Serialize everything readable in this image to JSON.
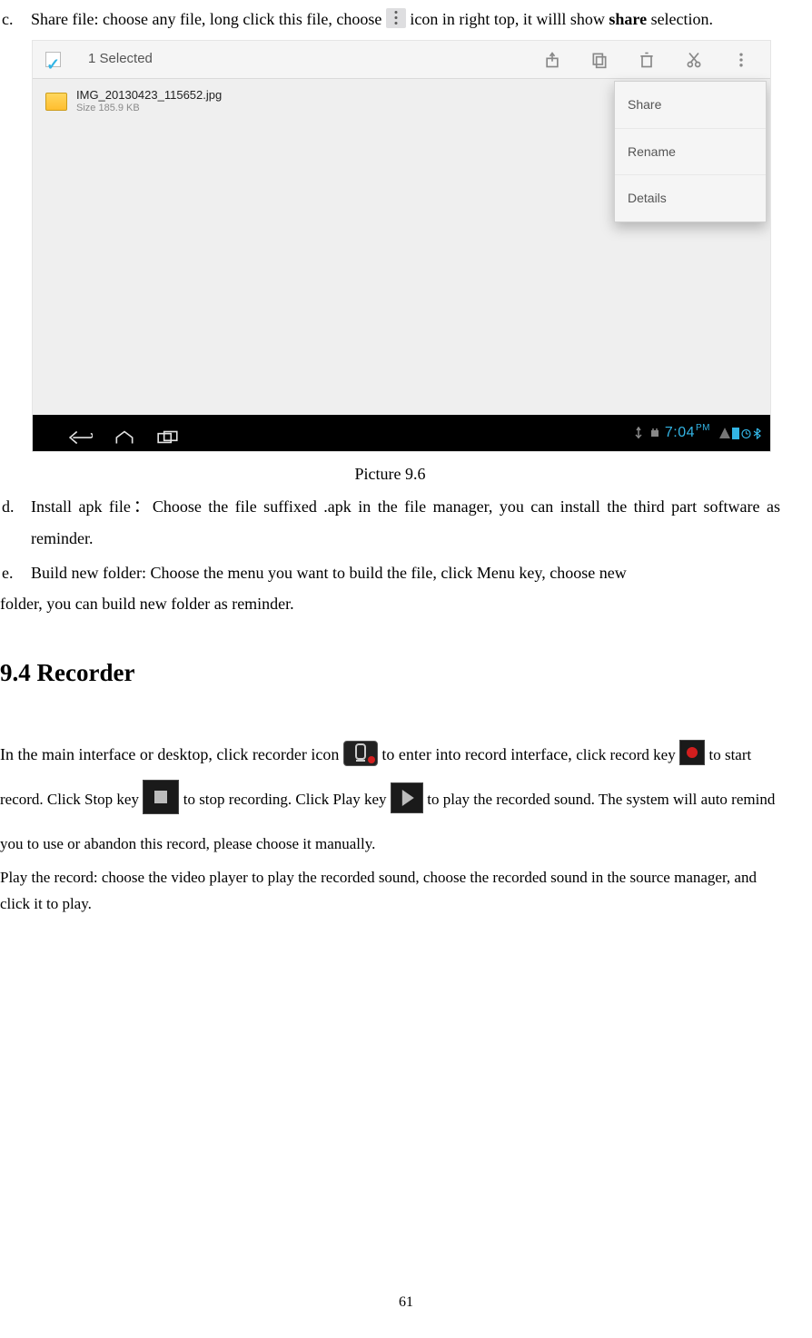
{
  "items": {
    "c": {
      "marker": "c.",
      "text_part1": "Share file: choose any file, long click this file, choose ",
      "text_part2": " icon in right top, it willl show ",
      "text_bold": "share",
      "text_part3": " selection."
    },
    "d": {
      "marker": "d.",
      "text": "Install apk file：Choose the file suffixed .apk in the file manager, you can install the third part software as reminder."
    },
    "e": {
      "marker": "e.",
      "text_line1": "Build new folder: Choose the menu you want to build the file, click Menu key, choose new",
      "text_line2": "folder, you can build new folder as reminder."
    }
  },
  "screenshot": {
    "selected_label": "1 Selected",
    "file_name": "IMG_20130423_115652.jpg",
    "file_meta": "Size 185.9 KB",
    "popup": {
      "share": "Share",
      "rename": "Rename",
      "details": "Details"
    },
    "time": "7:04",
    "time_suffix": "PM"
  },
  "caption": "Picture 9.6",
  "heading_recorder": "9.4 Recorder",
  "recorder": {
    "p1a": "In the main interface or desktop, click recorder icon ",
    "p1b": " to enter into record interface, ",
    "p1c": "click record key ",
    "p1d": " to start record. Click Stop key ",
    "p1e": " to stop recording. Click Play key ",
    "p1f": " to play the recorded sound. The system will auto remind you to use or abandon this record, please choose it manually.",
    "p2": "Play the record: choose the video player to play the recorded sound, choose the recorded sound in the source manager, and click it to play."
  },
  "page_number": "61"
}
